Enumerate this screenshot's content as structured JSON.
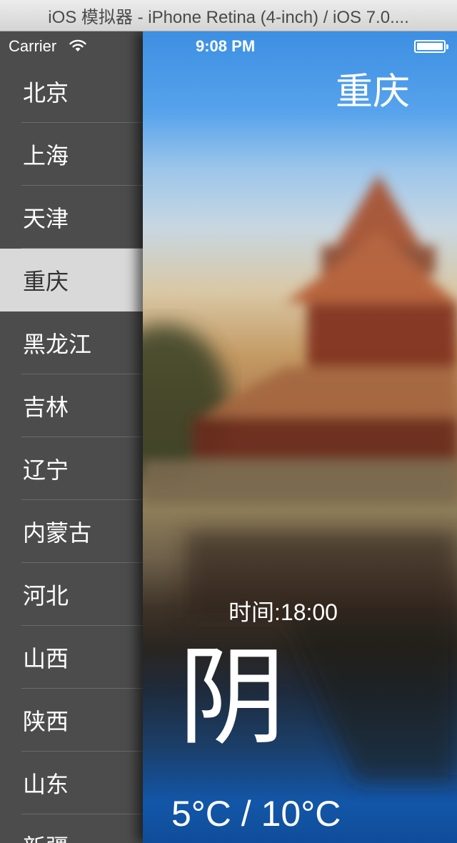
{
  "window": {
    "title": "iOS 模拟器 - iPhone Retina (4-inch) / iOS 7.0...."
  },
  "status_bar": {
    "carrier": "Carrier",
    "time": "9:08 PM"
  },
  "sidebar": {
    "items": [
      {
        "label": "北京"
      },
      {
        "label": "上海"
      },
      {
        "label": "天津"
      },
      {
        "label": "重庆",
        "selected": true
      },
      {
        "label": "黑龙江"
      },
      {
        "label": "吉林"
      },
      {
        "label": "辽宁"
      },
      {
        "label": "内蒙古"
      },
      {
        "label": "河北"
      },
      {
        "label": "山西"
      },
      {
        "label": "陕西"
      },
      {
        "label": "山东"
      },
      {
        "label": "新疆"
      }
    ]
  },
  "weather": {
    "city": "重庆",
    "time": "时间:18:00",
    "condition": "阴",
    "temperature": "5°C / 10°C"
  },
  "colors": {
    "sidebar_bg": "#4c4c4c",
    "selected_bg": "#d9d9d9",
    "sky": "#3d8fe3",
    "water": "#0f4d9a"
  }
}
